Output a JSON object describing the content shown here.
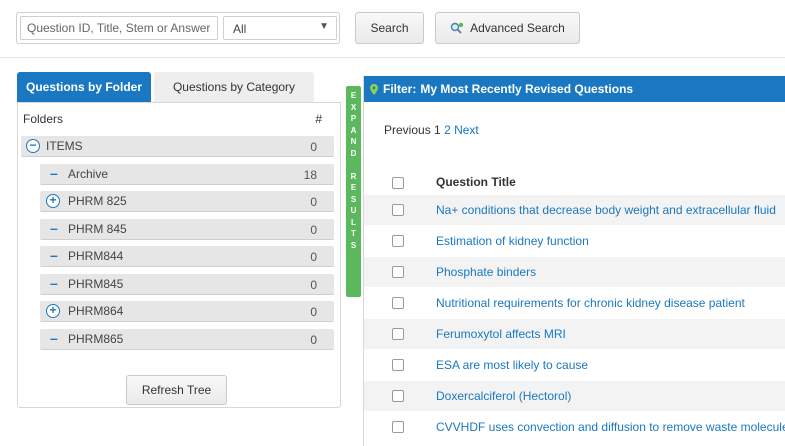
{
  "search": {
    "placeholder": "Question ID, Title, Stem or Answers",
    "scope_selected": "All",
    "search_label": "Search",
    "advanced_label": "Advanced Search"
  },
  "tabs": {
    "folder": "Questions by Folder",
    "category": "Questions by Category"
  },
  "folders": {
    "header": "Folders",
    "count_header": "#",
    "items": [
      {
        "label": "ITEMS",
        "count": "0"
      },
      {
        "label": "Archive",
        "count": "18"
      },
      {
        "label": "PHRM 825",
        "count": "0"
      },
      {
        "label": "PHRM 845",
        "count": "0"
      },
      {
        "label": "PHRM844",
        "count": "0"
      },
      {
        "label": "PHRM845",
        "count": "0"
      },
      {
        "label": "PHRM864",
        "count": "0"
      },
      {
        "label": "PHRM865",
        "count": "0"
      }
    ],
    "refresh_label": "Refresh Tree"
  },
  "expand_strip": {
    "letters": [
      "E",
      "X",
      "P",
      "A",
      "N",
      "D",
      "",
      "R",
      "E",
      "S",
      "U",
      "L",
      "T",
      "S"
    ]
  },
  "filter": {
    "prefix": "Filter:",
    "name": "My Most Recently Revised Questions"
  },
  "pager": {
    "previous": "Previous",
    "pages": [
      "1",
      "2"
    ],
    "next": "Next"
  },
  "questions": {
    "header": "Question Title",
    "items": [
      "Na+ conditions that decrease body weight and extracellular fluid",
      "Estimation of kidney function",
      "Phosphate binders",
      "Nutritional requirements for chronic kidney disease patient",
      "Ferumoxytol affects MRI",
      "ESA are most likely to cause",
      "Doxercalciferol (Hectorol)",
      "CVVHDF uses convection and diffusion to remove waste molecules"
    ]
  },
  "colors": {
    "primary": "#1a78c2",
    "expand": "#5cb85c"
  }
}
